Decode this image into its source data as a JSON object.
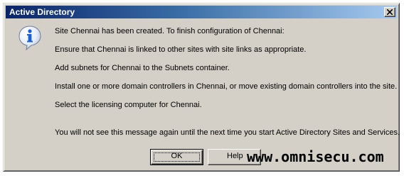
{
  "window": {
    "title": "Active Directory",
    "close_symbol": "x"
  },
  "icon": "info-icon",
  "message": {
    "line1": "Site Chennai has been created. To finish configuration of Chennai:",
    "line2": "Ensure that Chennai is linked to other sites with site links as appropriate.",
    "line3": "Add subnets for Chennai to the Subnets container.",
    "line4": "Install one or more domain controllers in Chennai, or move existing domain controllers into the site.",
    "line5": "Select the licensing computer for Chennai.",
    "line6": "You will not see this message again until the next time you start Active Directory Sites and Services."
  },
  "buttons": {
    "ok_label": "OK",
    "help_label": "Help"
  },
  "watermark": "www.omnisecu.com",
  "colors": {
    "title_start": "#0a246a",
    "title_end": "#a6caf0",
    "dialog_bg": "#d4d0c8",
    "icon_blue": "#1c5fd6"
  }
}
